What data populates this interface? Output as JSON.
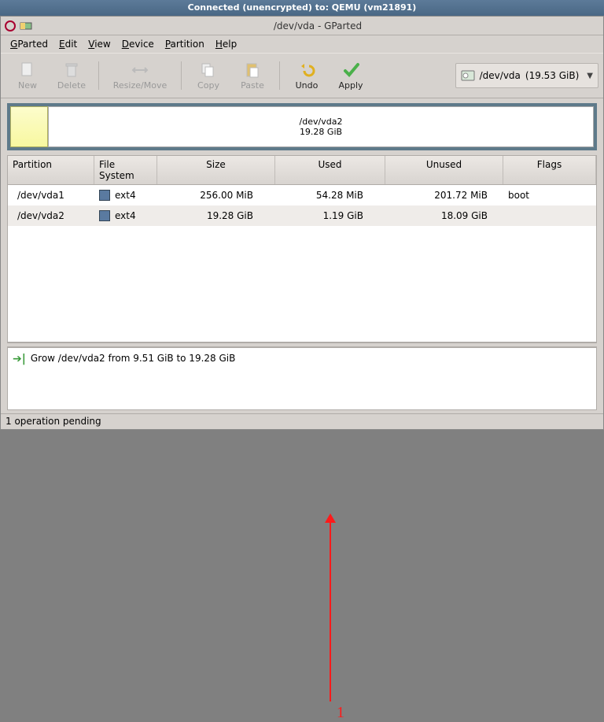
{
  "vm_title": "Connected (unencrypted) to: QEMU (vm21891)",
  "window_title": "/dev/vda - GParted",
  "menus": {
    "gparted": "GParted",
    "edit": "Edit",
    "view": "View",
    "device": "Device",
    "partition": "Partition",
    "help": "Help"
  },
  "toolbar": {
    "new": "New",
    "delete": "Delete",
    "resize": "Resize/Move",
    "copy": "Copy",
    "paste": "Paste",
    "undo": "Undo",
    "apply": "Apply"
  },
  "device_selector": {
    "path": "/dev/vda",
    "size": "(19.53 GiB)"
  },
  "diskvis": {
    "label": "/dev/vda2",
    "size": "19.28 GiB"
  },
  "columns": {
    "partition": "Partition",
    "fs": "File System",
    "size": "Size",
    "used": "Used",
    "unused": "Unused",
    "flags": "Flags"
  },
  "rows": [
    {
      "partition": "/dev/vda1",
      "fs": "ext4",
      "size": "256.00 MiB",
      "used": "54.28 MiB",
      "unused": "201.72 MiB",
      "flags": "boot"
    },
    {
      "partition": "/dev/vda2",
      "fs": "ext4",
      "size": "19.28 GiB",
      "used": "1.19 GiB",
      "unused": "18.09 GiB",
      "flags": ""
    }
  ],
  "operation": "Grow /dev/vda2 from 9.51 GiB to 19.28 GiB",
  "status": "1 operation pending",
  "annotation": "1"
}
